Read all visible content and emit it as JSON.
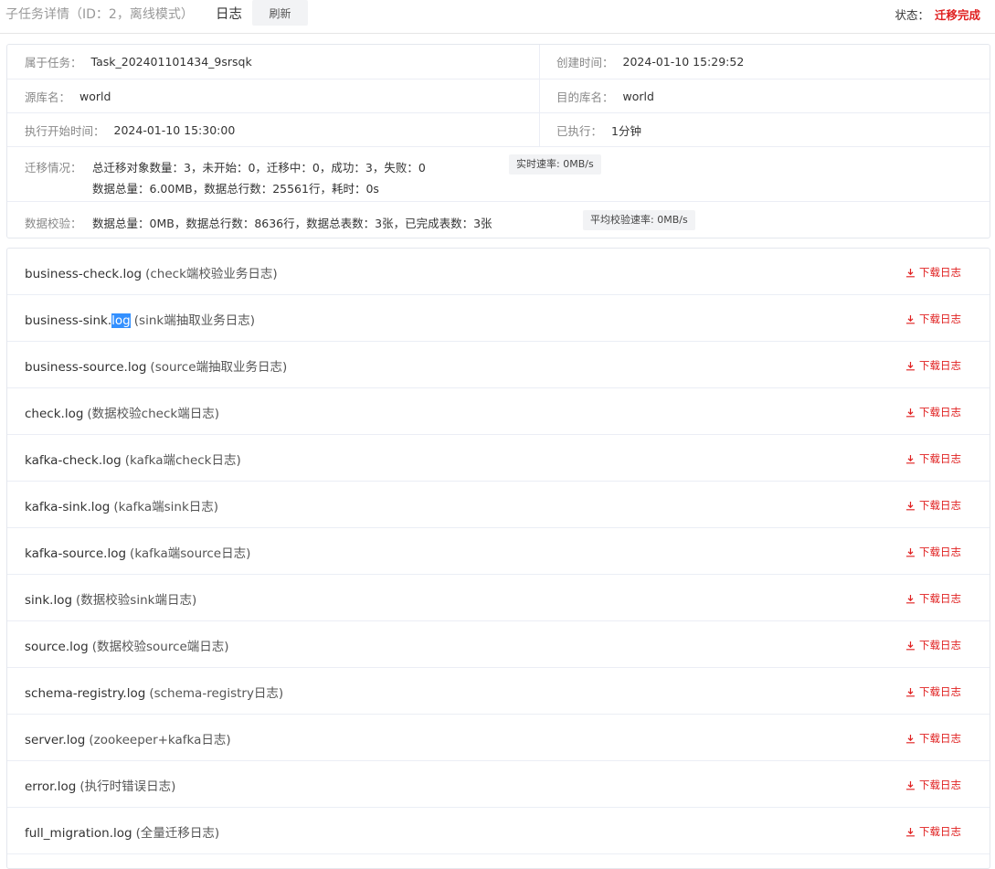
{
  "header": {
    "title": "子任务详情（ID：2，离线模式）",
    "tab_log": "日志",
    "refresh": "刷新",
    "status_label": "状态：",
    "status_value": "迁移完成"
  },
  "info": {
    "task_label": "属于任务：",
    "task_value": "Task_202401101434_9srsqk",
    "created_label": "创建时间：",
    "created_value": "2024-01-10 15:29:52",
    "source_db_label": "源库名：",
    "source_db_value": "world",
    "target_db_label": "目的库名：",
    "target_db_value": "world",
    "start_label": "执行开始时间：",
    "start_value": "2024-01-10 15:30:00",
    "elapsed_label": "已执行：",
    "elapsed_value": "1分钟",
    "migration_label": "迁移情况：",
    "migration_line1": "总迁移对象数量：3，未开始：0，迁移中：0，成功：3，失败：0",
    "migration_line2": "数据总量：6.00MB，数据总行数：25561行，耗时：0s",
    "realtime_speed": "实时速率: 0MB/s",
    "check_label": "数据校验：",
    "check_value": "数据总量：0MB，数据总行数：8636行，数据总表数：3张，已完成表数：3张",
    "avg_check_speed": "平均校验速率: 0MB/s"
  },
  "download_label": "下载日志",
  "logs": [
    {
      "name": "business-check.log",
      "desc": "(check端校验业务日志)"
    },
    {
      "name_pre": "business-sink.",
      "name_hl": "log",
      "desc": "(sink端抽取业务日志)"
    },
    {
      "name": "business-source.log",
      "desc": "(source端抽取业务日志)"
    },
    {
      "name": "check.log",
      "desc": "(数据校验check端日志)"
    },
    {
      "name": "kafka-check.log",
      "desc": "(kafka端check日志)"
    },
    {
      "name": "kafka-sink.log",
      "desc": "(kafka端sink日志)"
    },
    {
      "name": "kafka-source.log",
      "desc": "(kafka端source日志)"
    },
    {
      "name": "sink.log",
      "desc": "(数据校验sink端日志)"
    },
    {
      "name": "source.log",
      "desc": "(数据校验source端日志)"
    },
    {
      "name": "schema-registry.log",
      "desc": "(schema-registry日志)"
    },
    {
      "name": "server.log",
      "desc": "(zookeeper+kafka日志)"
    },
    {
      "name": "error.log",
      "desc": "(执行时错误日志)"
    },
    {
      "name": "full_migration.log",
      "desc": "(全量迁移日志)"
    }
  ],
  "colors": {
    "accent_red": "#e02020",
    "selection_blue": "#3390ff"
  }
}
